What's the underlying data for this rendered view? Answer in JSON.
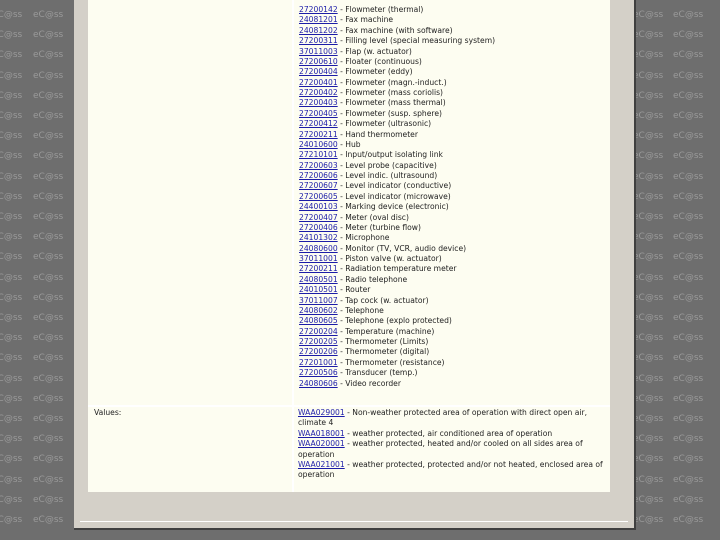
{
  "watermark": "eC@ss",
  "devices": [
    {
      "code": "27200142",
      "name": "Flowmeter (thermal)"
    },
    {
      "code": "24081201",
      "name": "Fax machine"
    },
    {
      "code": "24081202",
      "name": "Fax machine (with software)"
    },
    {
      "code": "27200311",
      "name": "Filling level (special measuring system)"
    },
    {
      "code": "37011003",
      "name": "Flap (w. actuator)"
    },
    {
      "code": "27200610",
      "name": "Floater (continuous)"
    },
    {
      "code": "27200404",
      "name": "Flowmeter (eddy)"
    },
    {
      "code": "27200401",
      "name": "Flowmeter (magn.-induct.)"
    },
    {
      "code": "27200402",
      "name": "Flowmeter (mass coriolis)"
    },
    {
      "code": "27200403",
      "name": "Flowmeter (mass thermal)"
    },
    {
      "code": "27200405",
      "name": "Flowmeter (susp. sphere)"
    },
    {
      "code": "27200412",
      "name": "Flowmeter (ultrasonic)"
    },
    {
      "code": "27200211",
      "name": "Hand thermometer"
    },
    {
      "code": "24010600",
      "name": "Hub"
    },
    {
      "code": "27210101",
      "name": "Input/output isolating link"
    },
    {
      "code": "27200603",
      "name": "Level probe (capacitive)"
    },
    {
      "code": "27200606",
      "name": "Level indic. (ultrasound)"
    },
    {
      "code": "27200607",
      "name": "Level indicator (conductive)"
    },
    {
      "code": "27200605",
      "name": "Level indicator (microwave)"
    },
    {
      "code": "24400103",
      "name": "Marking device (electronic)"
    },
    {
      "code": "27200407",
      "name": "Meter (oval disc)"
    },
    {
      "code": "27200406",
      "name": "Meter (turbine flow)"
    },
    {
      "code": "24101302",
      "name": "Microphone"
    },
    {
      "code": "24080600",
      "name": "Monitor (TV, VCR, audio device)"
    },
    {
      "code": "37011001",
      "name": "Piston valve (w. actuator)"
    },
    {
      "code": "27200211",
      "name": "Radiation temperature meter"
    },
    {
      "code": "24080501",
      "name": "Radio telephone"
    },
    {
      "code": "24010501",
      "name": "Router"
    },
    {
      "code": "37011007",
      "name": "Tap cock (w. actuator)"
    },
    {
      "code": "24080602",
      "name": "Telephone"
    },
    {
      "code": "24080605",
      "name": "Telephone (explo protected)"
    },
    {
      "code": "27200204",
      "name": "Temperature (machine)"
    },
    {
      "code": "27200205",
      "name": "Thermometer (Limits)"
    },
    {
      "code": "27200206",
      "name": "Thermometer (digital)"
    },
    {
      "code": "27201001",
      "name": "Thermometer (resistance)"
    },
    {
      "code": "27200506",
      "name": "Transducer (temp.)"
    },
    {
      "code": "24080606",
      "name": "Video recorder"
    }
  ],
  "values_label": "Values:",
  "values": [
    {
      "code": "WAA029001",
      "text": "Non-weather protected area of operation with direct open air, climate 4"
    },
    {
      "code": "WAA018001",
      "text": "weather protected, air conditioned area of operation"
    },
    {
      "code": "WAA020001",
      "text": "weather protected, heated and/or cooled on all sides area of operation"
    },
    {
      "code": "WAA021001",
      "text": "weather protected, protected and/or not heated, enclosed area of operation"
    }
  ]
}
